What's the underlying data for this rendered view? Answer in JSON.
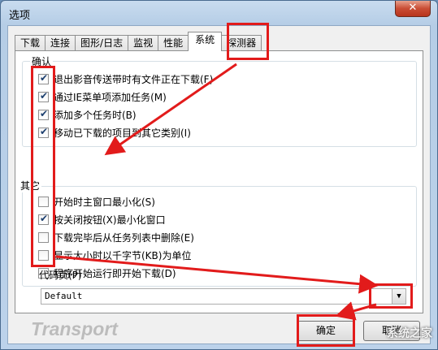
{
  "window": {
    "title": "选项",
    "close_glyph": "✕"
  },
  "tabs": [
    {
      "label": "下载",
      "active": false
    },
    {
      "label": "连接",
      "active": false
    },
    {
      "label": "图形/日志",
      "active": false
    },
    {
      "label": "监视",
      "active": false
    },
    {
      "label": "性能",
      "active": false
    },
    {
      "label": "系统",
      "active": true
    },
    {
      "label": "探测器",
      "active": false
    }
  ],
  "confirm_group": {
    "label": "确认",
    "items": [
      {
        "label": "退出影音传送带时有文件正在下载(F)",
        "checked": true
      },
      {
        "label": "通过IE菜单项添加任务(M)",
        "checked": true
      },
      {
        "label": "添加多个任务时(B)",
        "checked": true
      },
      {
        "label": "移动已下载的项目到其它类别(I)",
        "checked": true
      }
    ]
  },
  "other_group": {
    "label": "其它",
    "items": [
      {
        "label": "开始时主窗口最小化(S)",
        "checked": false
      },
      {
        "label": "按关闭按钮(X)最小化窗口",
        "checked": true
      },
      {
        "label": "下载完毕后从任务列表中删除(E)",
        "checked": false
      },
      {
        "label": "显示大小时以千字节(KB)为单位",
        "checked": false
      },
      {
        "label": "程序开始运行即开始下载(D)",
        "checked": false
      }
    ]
  },
  "codepage": {
    "label": "代码页(P)",
    "value": "Default"
  },
  "footer": {
    "brand": "Transport",
    "ok_label": "确定",
    "cancel_label": "取消"
  },
  "watermark": "系统之家",
  "annotation_color": "#e21b1b"
}
